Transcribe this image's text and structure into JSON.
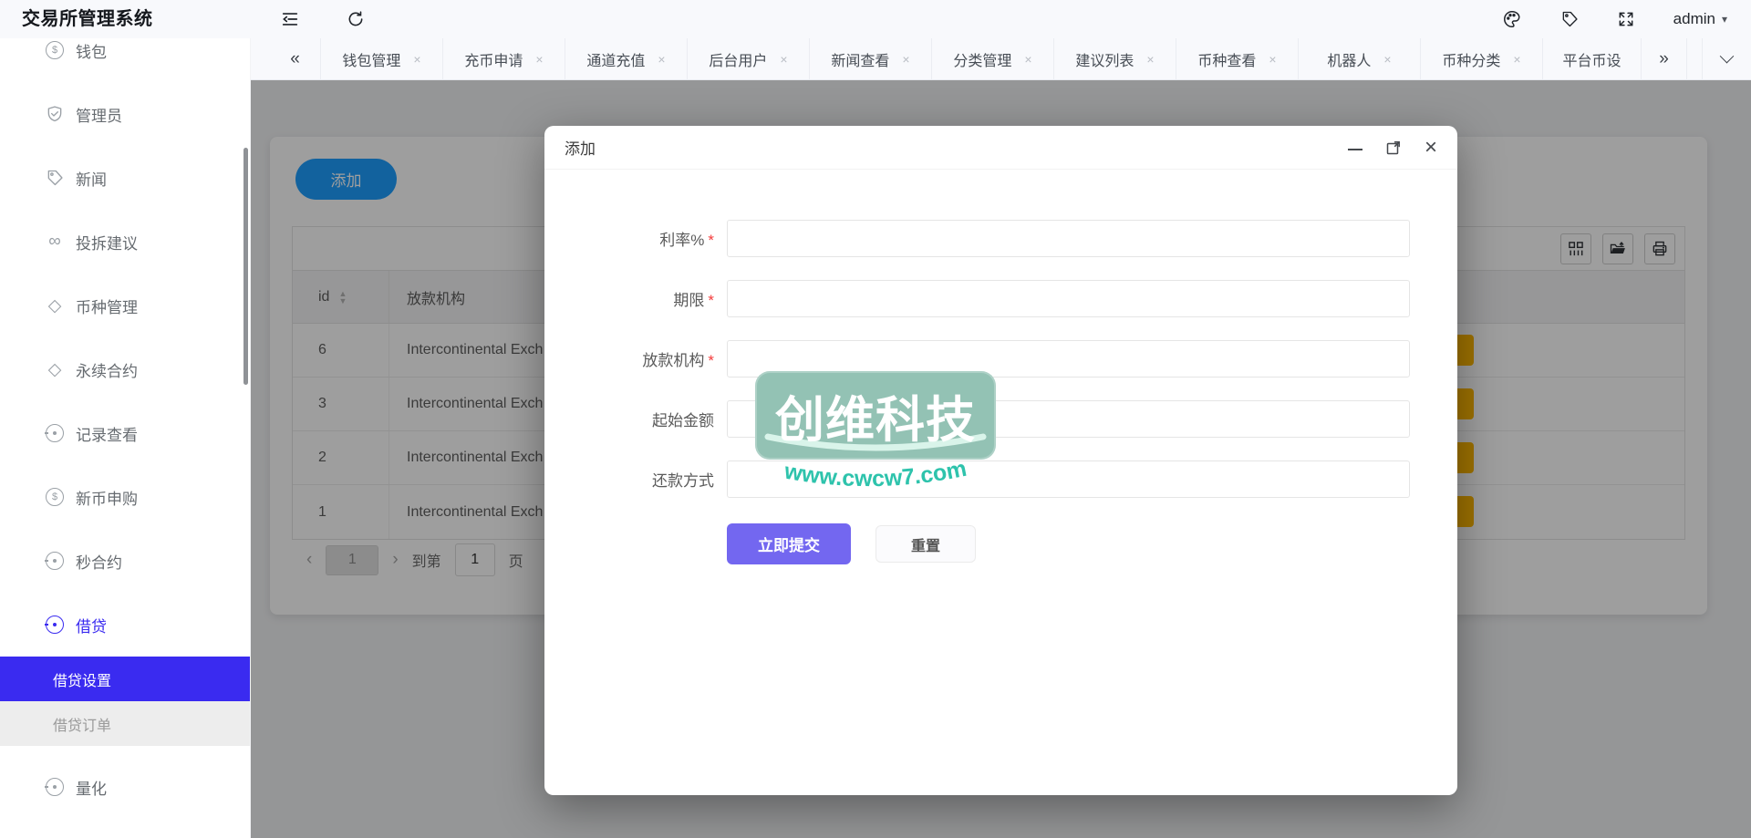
{
  "colors": {
    "accent_blue": "#1E9FFF",
    "primary_purple": "#7367F0",
    "active_menu_blue": "#3A2BF0",
    "action_orange": "#FFB800",
    "required_red": "#F43B3B",
    "watermark_box_teal": "#8FC0B2",
    "watermark_text_teal": "#2EC3AC"
  },
  "icons": {
    "menu_fold": "three-lines-with-arrow",
    "refresh": "circular-arrow",
    "palette": "paint-palette-outline",
    "tag": "price-tag-outline",
    "fullscreen": "expand-corners",
    "coin": "$ in circle",
    "shield_check": "shield with check",
    "infinity": "∞",
    "diamond": "◇",
    "compass": "circle with center dot",
    "close": "×",
    "caret_down": "▾"
  },
  "header": {
    "title": "交易所管理系统",
    "user": "admin",
    "caret": "▾"
  },
  "tabbar": {
    "collapse_left": "«",
    "collapse_right": "»",
    "close_glyph": "×",
    "tabs": [
      {
        "label": "钱包管理"
      },
      {
        "label": "充币申请"
      },
      {
        "label": "通道充值"
      },
      {
        "label": "后台用户"
      },
      {
        "label": "新闻查看"
      },
      {
        "label": "分类管理"
      },
      {
        "label": "建议列表"
      },
      {
        "label": "币种查看"
      },
      {
        "label": "机器人"
      },
      {
        "label": "币种分类"
      },
      {
        "label": "平台币设",
        "truncated": true
      }
    ]
  },
  "sidebar": {
    "items": [
      {
        "label": "钱包",
        "icon": "coin-icon"
      },
      {
        "label": "管理员",
        "icon": "shield-check-icon"
      },
      {
        "label": "新闻",
        "icon": "tag-icon"
      },
      {
        "label": "投拆建议",
        "icon": "infinity-icon"
      },
      {
        "label": "币种管理",
        "icon": "diamond-icon"
      },
      {
        "label": "永续合约",
        "icon": "diamond-icon"
      },
      {
        "label": "记录查看",
        "icon": "compass-icon"
      },
      {
        "label": "新币申购",
        "icon": "coin-icon"
      },
      {
        "label": "秒合约",
        "icon": "compass-icon"
      },
      {
        "label": "借贷",
        "icon": "compass-icon",
        "active": true
      }
    ],
    "loan_children": [
      {
        "label": "借贷设置",
        "active": true
      },
      {
        "label": "借贷订单",
        "active": false
      }
    ],
    "items_bottom": [
      {
        "label": "量化",
        "icon": "compass-icon"
      }
    ]
  },
  "content": {
    "add_button": "添加",
    "table": {
      "columns": [
        {
          "label": "id",
          "sortable": true
        },
        {
          "label": "放款机构",
          "sortable": false
        }
      ],
      "sort_asc": "▲",
      "sort_desc": "▼",
      "rows": [
        {
          "id": "6",
          "institution": "Intercontinental Exch"
        },
        {
          "id": "3",
          "institution": "Intercontinental Exch"
        },
        {
          "id": "2",
          "institution": "Intercontinental Exch"
        },
        {
          "id": "1",
          "institution": "Intercontinental Exch"
        }
      ]
    },
    "pagination": {
      "prev": "‹",
      "page": "1",
      "next": "›",
      "goto_prefix": "到第",
      "goto_value": "1",
      "goto_suffix": "页"
    }
  },
  "modal": {
    "title": "添加",
    "required_mark": "*",
    "fields": [
      {
        "label": "利率%",
        "required": true
      },
      {
        "label": "期限",
        "required": true
      },
      {
        "label": "放款机构",
        "required": true
      },
      {
        "label": "起始金额",
        "required": false
      },
      {
        "label": "还款方式",
        "required": false
      }
    ],
    "submit_label": "立即提交",
    "reset_label": "重置",
    "close_glyph": "×"
  },
  "watermark": {
    "brand": "创维科技",
    "url": "www.cwcw7.com"
  }
}
